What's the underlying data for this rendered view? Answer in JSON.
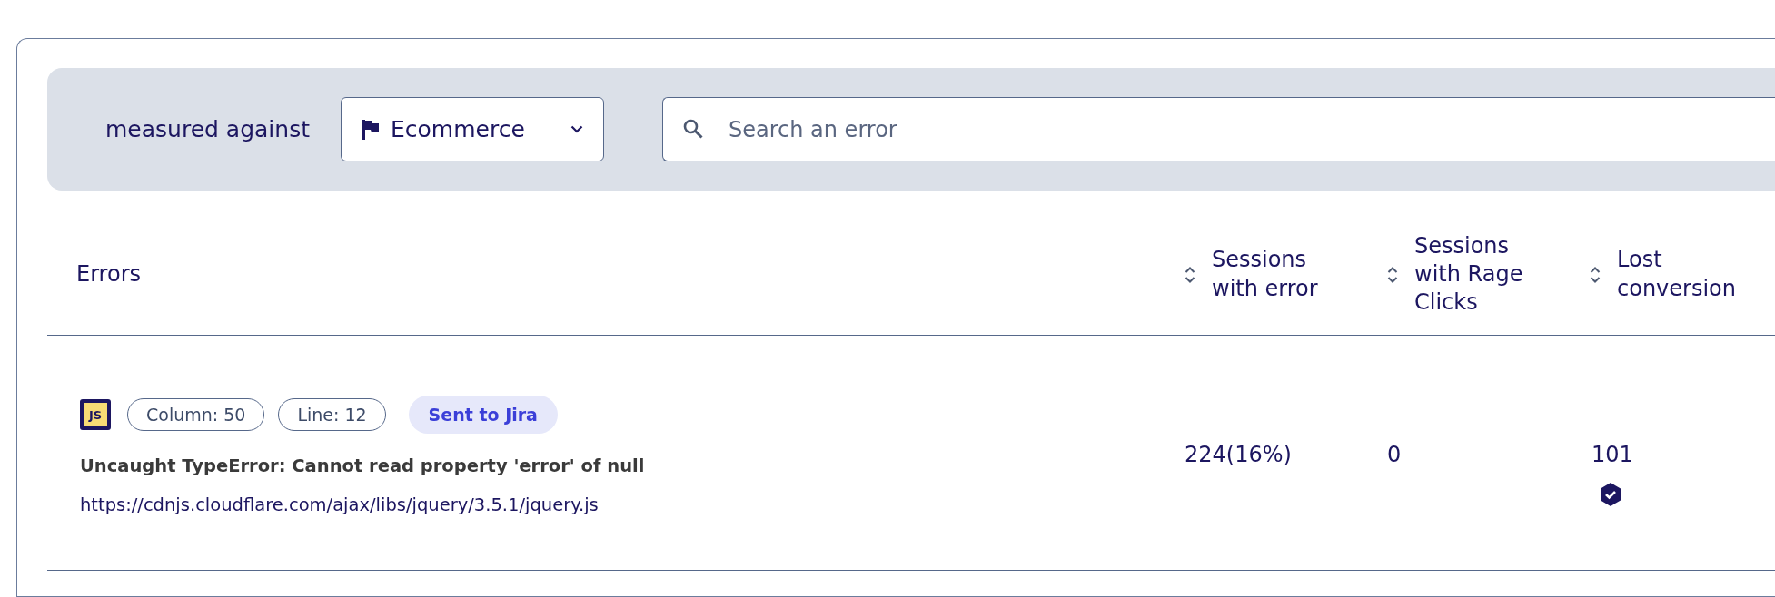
{
  "toolbar": {
    "label": "measured against",
    "dropdown": {
      "value": "Ecommerce"
    },
    "search": {
      "placeholder": "Search an error"
    }
  },
  "table": {
    "columns": [
      {
        "label": "Errors",
        "sortable": false
      },
      {
        "label": "Sessions with error",
        "sortable": true
      },
      {
        "label": "Sessions with Rage Clicks",
        "sortable": true
      },
      {
        "label": "Lost conversion",
        "sortable": true
      }
    ],
    "rows": [
      {
        "file_type": "JS",
        "tags": [
          "Column: 50",
          "Line: 12"
        ],
        "status": "Sent to Jira",
        "message": "Uncaught TypeError: Cannot read property 'error' of null",
        "url": "https://cdnjs.cloudflare.com/ajax/libs/jquery/3.5.1/jquery.js",
        "sessions_with_error": "224(16%)",
        "rage_clicks": "0",
        "lost_conversion": "101",
        "verified": true
      }
    ]
  }
}
